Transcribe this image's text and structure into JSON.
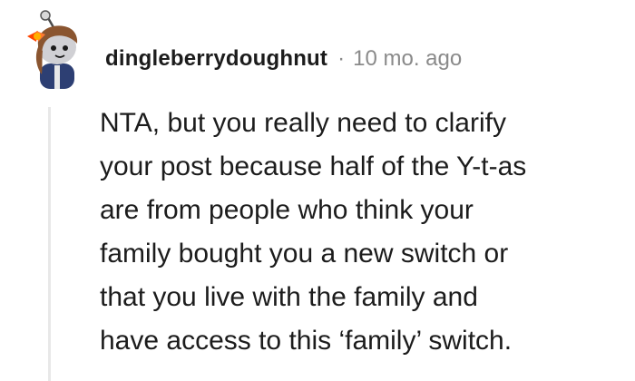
{
  "comment": {
    "author": "dingleberrydoughnut",
    "separator": "·",
    "timestamp": "10 mo. ago",
    "avatar_icon": "snoo-avatar-icon",
    "body_lines": [
      "NTA, but you really need to clarify",
      "your post because half of the Y-t-as",
      "are from people who think your",
      "family bought you a new switch or",
      "that you live with the family and",
      "have access to this ‘family’ switch."
    ]
  },
  "colors": {
    "username": "#1c1c1c",
    "meta_gray": "#8a8a8a",
    "thread_line": "#e8e8e8",
    "avatar_orange": "#ff4500"
  }
}
